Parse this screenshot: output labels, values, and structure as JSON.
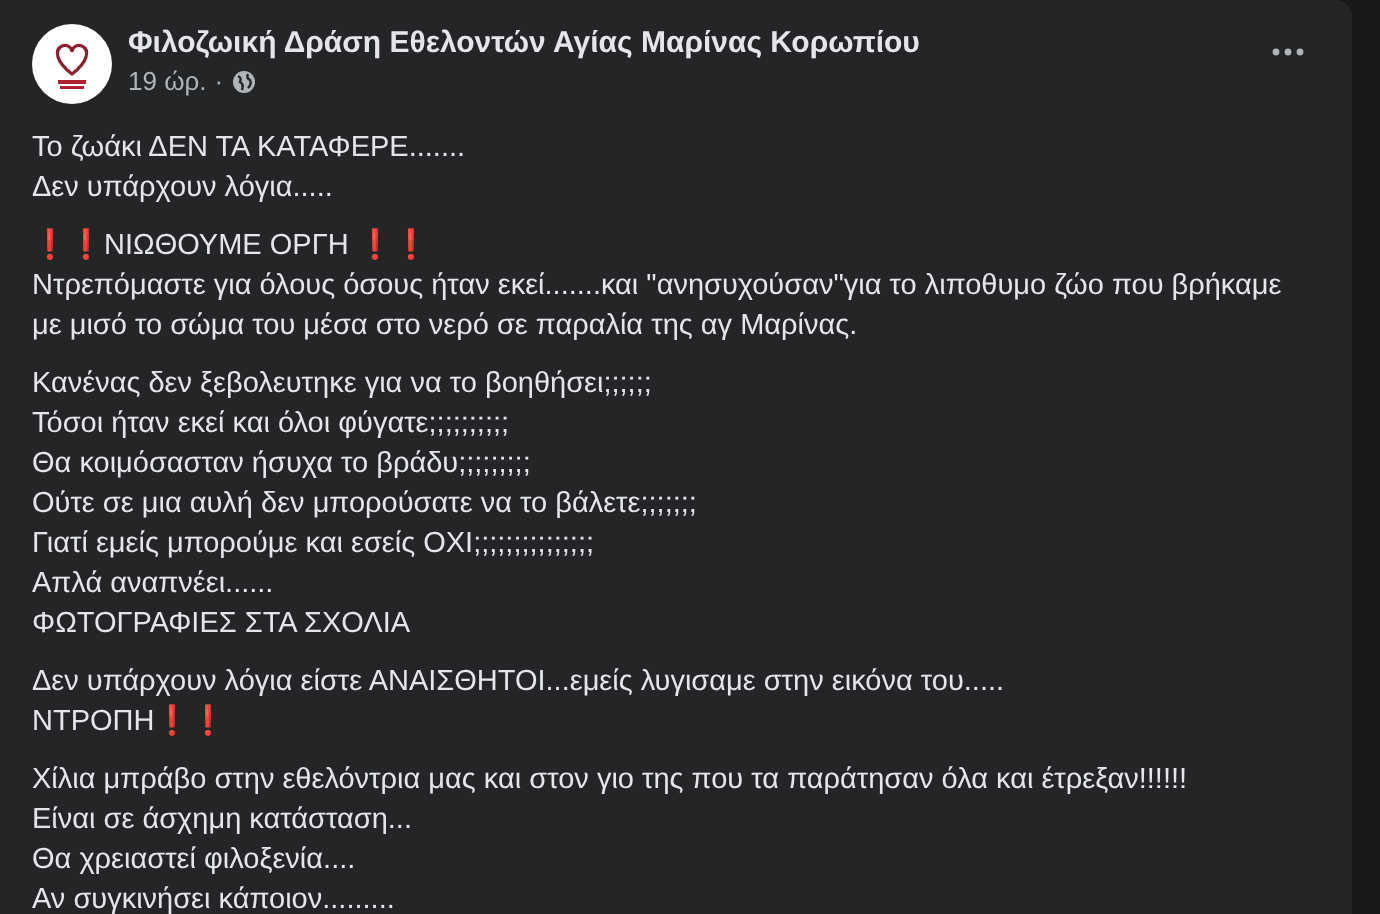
{
  "post": {
    "author": "Φιλοζωική Δράση Εθελοντών Αγίας Μαρίνας Κορωπίου",
    "time": "19 ώρ.",
    "separator": "·",
    "paragraphs": [
      {
        "lines": [
          {
            "text": "Το ζωάκι ΔΕΝ ΤΑ ΚΑΤΑΦΕΡΕ......."
          },
          {
            "text": "Δεν υπάρχουν λόγια....."
          }
        ]
      },
      {
        "lines": [
          {
            "before": "❗❗",
            "text": "ΝΙΩΘΟΥΜΕ ΟΡΓΗ ",
            "after": "❗❗"
          },
          {
            "text": "Ντρεπόμαστε για όλους όσους ήταν εκεί.......και \"ανησυχούσαν\"για το λιποθυμο ζώο που βρήκαμε με μισό το σώμα του μέσα στο νερό σε παραλία της αγ Μαρίνας."
          }
        ]
      },
      {
        "lines": [
          {
            "text": "Κανένας δεν ξεβολευτηκε για να το βοηθήσει;;;;;;"
          },
          {
            "text": "Τόσοι ήταν εκεί και όλοι φύγατε;;;;;;;;;;"
          },
          {
            "text": "Θα κοιμόσασταν ήσυχα το βράδυ;;;;;;;;;"
          },
          {
            "text": "Ούτε σε μια αυλή δεν μπορούσατε να το βάλετε;;;;;;;"
          },
          {
            "text": "Γιατί εμείς μπορούμε και εσείς ΟΧΙ;;;;;;;;;;;;;;;"
          },
          {
            "text": "Απλά αναπνέει......"
          },
          {
            "text": "ΦΩΤΟΓΡΑΦΙΕΣ ΣΤΑ ΣΧΟΛΙΑ"
          }
        ]
      },
      {
        "lines": [
          {
            "text": "Δεν υπάρχουν λόγια είστε ΑΝΑΙΣΘΗΤΟΙ...εμείς λυγισαμε στην εικόνα του....."
          },
          {
            "text": "ΝΤΡΟΠΗ",
            "after": "❗❗"
          }
        ]
      },
      {
        "lines": [
          {
            "text": "Χίλια μπράβο στην εθελόντρια μας και στον γιο της που τα παράτησαν όλα και έτρεξαν!!!!!!"
          },
          {
            "text": "Είναι σε άσχημη κατάσταση..."
          },
          {
            "text": "Θα χρειαστεί φιλοξενία...."
          },
          {
            "text": "Αν συγκινήσει κάποιον........."
          }
        ]
      }
    ]
  }
}
